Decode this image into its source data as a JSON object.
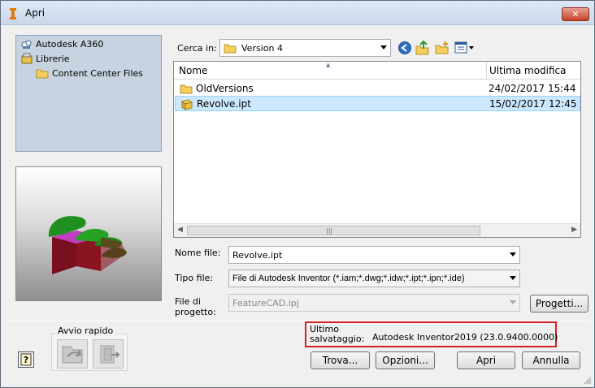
{
  "window": {
    "title": "Apri",
    "close_symbol": "✕"
  },
  "places": [
    {
      "label": "Autodesk A360",
      "icon": "cloud-icon"
    },
    {
      "label": "Librerie",
      "icon": "libraries-icon"
    },
    {
      "label": "Content Center Files",
      "icon": "folder-icon"
    }
  ],
  "look_in": {
    "label": "Cerca in:",
    "value": "Version 4"
  },
  "file_list": {
    "columns": [
      "Nome",
      "Ultima modifica"
    ],
    "rows": [
      {
        "name": "OldVersions",
        "date": "24/02/2017 15:44",
        "icon": "folder-icon",
        "selected": false
      },
      {
        "name": "Revolve.ipt",
        "date": "15/02/2017 12:45",
        "icon": "part-file-icon",
        "selected": true
      }
    ]
  },
  "file_name": {
    "label": "Nome file:",
    "value": "Revolve.ipt"
  },
  "file_type": {
    "label": "Tipo file:",
    "value": "File di Autodesk Inventor (*.iam;*.dwg;*.idw;*.ipt;*.ipn;*.ide)"
  },
  "project_file": {
    "label_line1": "File di",
    "label_line2": "progetto:",
    "value": "FeatureCAD.ipj"
  },
  "buttons": {
    "projects": "Progetti...",
    "find": "Trova...",
    "options": "Opzioni...",
    "open": "Apri",
    "cancel": "Annulla"
  },
  "quick_launch": {
    "label": "Avvio rapido"
  },
  "last_saved": {
    "label_line1": "Ultimo",
    "label_line2": "salvataggio:",
    "value": "Autodesk Inventor2019 (23.0.9400.0000)"
  },
  "help": {
    "symbol": "?"
  },
  "colors": {
    "highlight_border": "#d42020",
    "selected_row": "#cce8ff",
    "places_bg": "#c7d3e0",
    "model_green": "#1e8a1e",
    "model_red": "#7a0f1e",
    "model_magenta": "#c23cc2"
  }
}
